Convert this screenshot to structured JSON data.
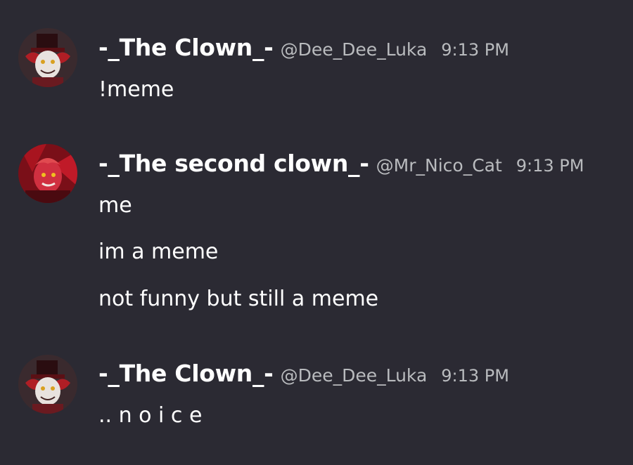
{
  "messages": [
    {
      "username": "-_The Clown_-",
      "handle": "@Dee_Dee_Luka",
      "time": "9:13 PM",
      "avatar": "clown-avatar",
      "lines": [
        "!meme"
      ]
    },
    {
      "username": "-_The second clown_-",
      "handle": "@Mr_Nico_Cat",
      "time": "9:13 PM",
      "avatar": "red-character-avatar",
      "lines": [
        "me",
        "im a meme",
        "not funny but still a meme"
      ]
    },
    {
      "username": "-_The Clown_-",
      "handle": "@Dee_Dee_Luka",
      "time": "9:13 PM",
      "avatar": "clown-avatar",
      "lines": [
        ".. n o i c e"
      ]
    }
  ],
  "colors": {
    "background": "#2b2a33",
    "username": "#ffffff",
    "meta": "#b9bbbe",
    "text": "#ffffff"
  }
}
